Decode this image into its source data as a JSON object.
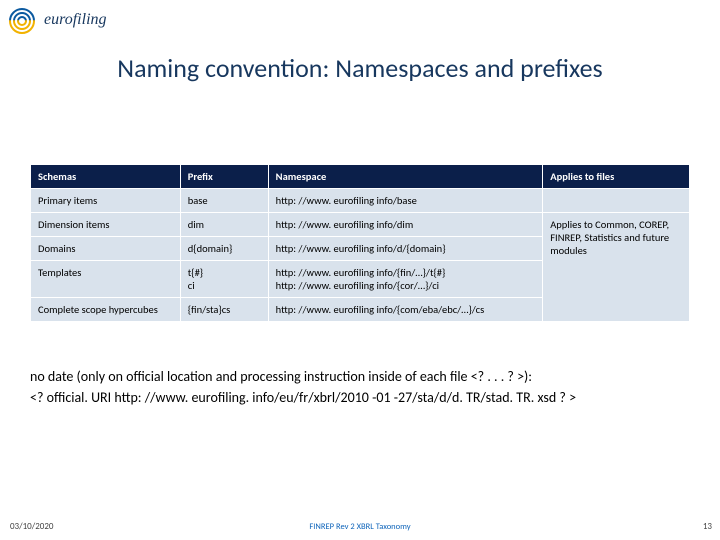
{
  "logo": {
    "text": "eurofiling"
  },
  "title": "Naming convention: Namespaces and prefixes",
  "table": {
    "headers": [
      "Schemas",
      "Prefix",
      "Namespace",
      "Applies to files"
    ],
    "rows": [
      {
        "schema": "Primary items",
        "prefix": "base",
        "ns": "http: //www. eurofiling info/base"
      },
      {
        "schema": "Dimension items",
        "prefix": "dim",
        "ns": "http: //www. eurofiling info/dim"
      },
      {
        "schema": "Domains",
        "prefix": "d{domain}",
        "ns": "http: //www. eurofiling info/d/{domain}"
      },
      {
        "schema": "Templates",
        "prefix": "t{#}\nci",
        "ns": "http: //www. eurofiling info/{fin/…}/t{#}\nhttp: //www. eurofiling info/{cor/…}/ci"
      },
      {
        "schema": "Complete scope hypercubes",
        "prefix": "{fin/sta}cs",
        "ns": "http: //www. eurofiling info/{com/eba/ebc/…}/cs"
      }
    ],
    "applies_merged": "Applies to Common, COREP, FINREP, Statistics and future modules"
  },
  "below": {
    "line1": "no date (only on official location and processing instruction inside of each file <? . . . ? >):",
    "line2": "<? official. URI http: //www. eurofiling. info/eu/fr/xbrl/2010 -01 -27/sta/d/d. TR/stad. TR. xsd ? >"
  },
  "footer": {
    "date": "03/10/2020",
    "middle": "FINREP Rev 2 XBRL Taxonomy",
    "page": "13"
  }
}
